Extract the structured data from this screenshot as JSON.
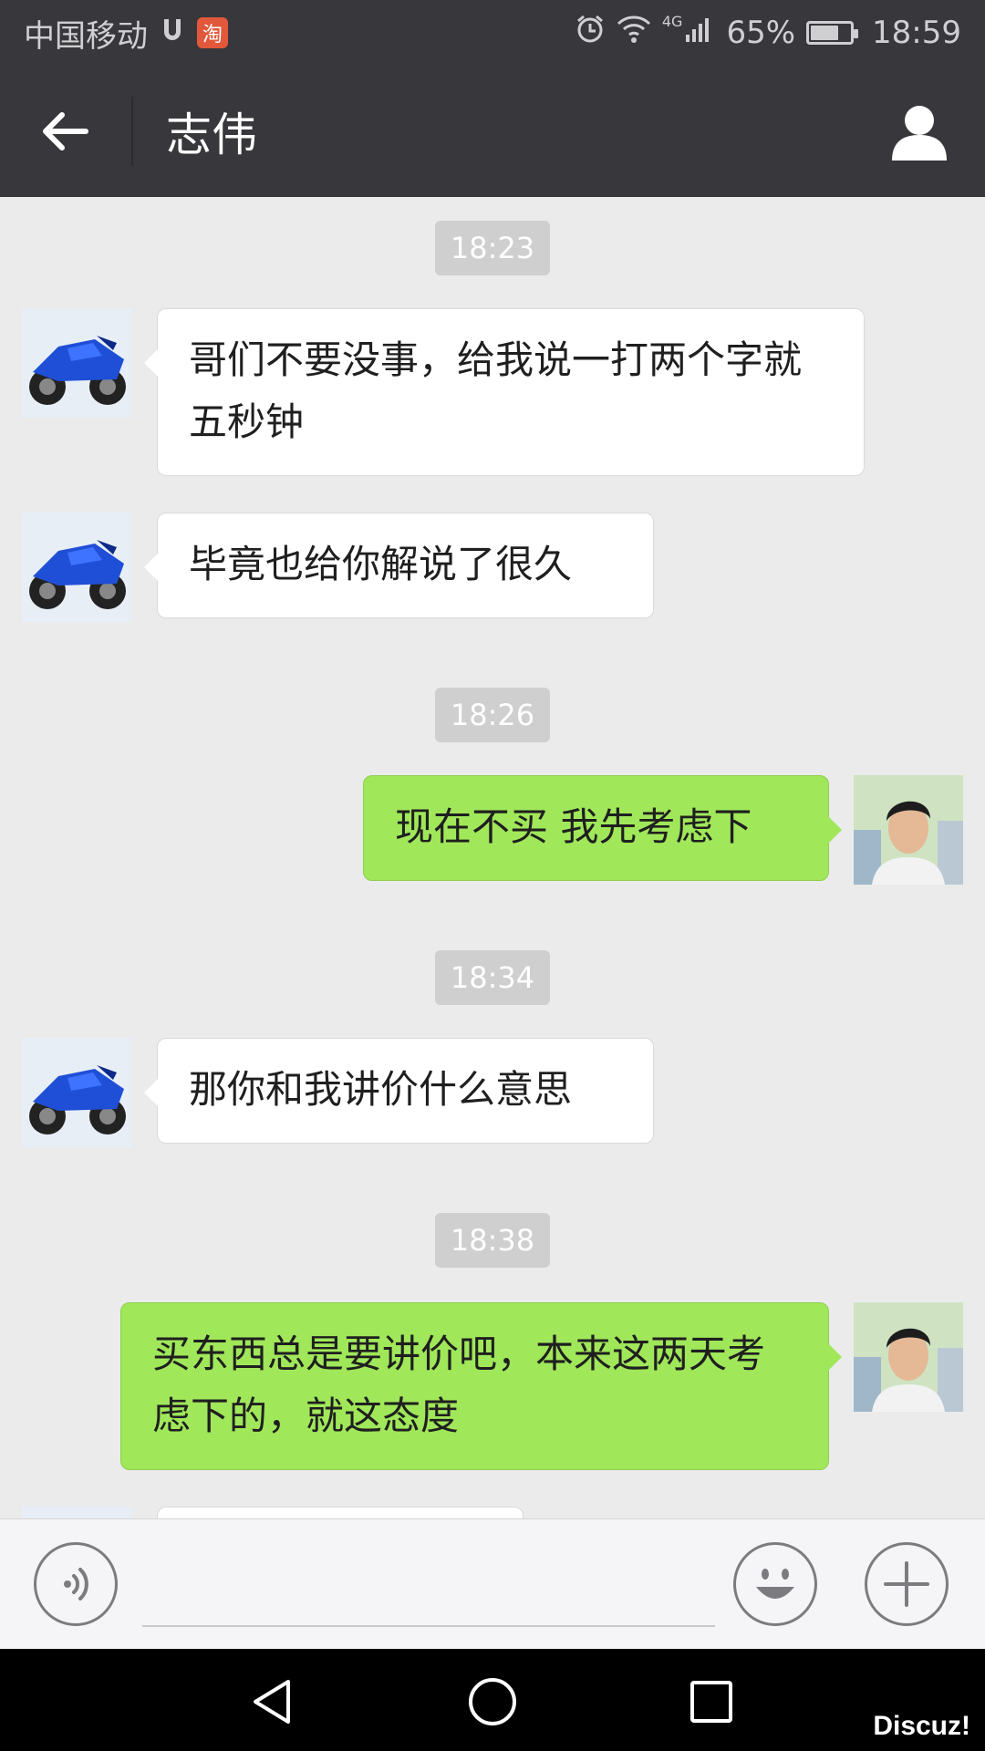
{
  "status_bar": {
    "carrier": "中国移动",
    "taobao_badge": "淘",
    "network": "4G",
    "battery": "65%",
    "battery_level": 0.65,
    "time": "18:59"
  },
  "header": {
    "title": "志伟"
  },
  "messages": [
    {
      "time": "18:23"
    },
    {
      "side": "in",
      "text": "哥们不要没事，给我说一打两个字就五秒钟"
    },
    {
      "side": "in",
      "text": "毕竟也给你解说了很久"
    },
    {
      "time": "18:26"
    },
    {
      "side": "out",
      "text": "现在不买 我先考虑下"
    },
    {
      "time": "18:34"
    },
    {
      "side": "in",
      "text": "那你和我讲价什么意思"
    },
    {
      "time": "18:38"
    },
    {
      "side": "out",
      "text": "买东西总是要讲价吧，本来这两天考虑下的，就这态度"
    }
  ],
  "input": {
    "value": "",
    "placeholder": ""
  },
  "watermark": "Discuz!",
  "icons": {
    "back": "arrow-left-icon",
    "profile": "person-icon",
    "voice": "voice-icon",
    "emoji": "emoji-icon",
    "more": "plus-icon",
    "nav_back": "triangle-back-icon",
    "nav_home": "circle-home-icon",
    "nav_recents": "square-recents-icon"
  },
  "colors": {
    "bar": "#38383c",
    "outgoing_bubble": "#a0e75a",
    "incoming_bubble": "#ffffff",
    "chat_background": "#ebebeb"
  }
}
